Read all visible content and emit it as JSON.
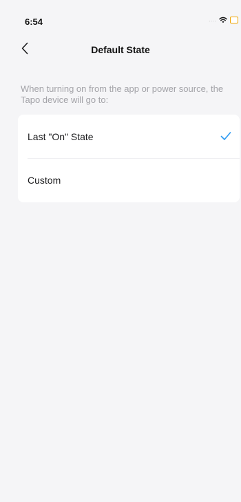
{
  "status_bar": {
    "time": "6:54",
    "signal": "....",
    "wifi_icon": "wifi-icon",
    "battery_icon": "battery-icon"
  },
  "nav": {
    "back_icon": "chevron-left-icon",
    "title": "Default State"
  },
  "description": "When turning on from the app or power source, the Tapo device will go to:",
  "options": [
    {
      "label": "Last \"On\" State",
      "selected": true
    },
    {
      "label": "Custom",
      "selected": false
    }
  ],
  "colors": {
    "accent": "#2f9bf2",
    "background": "#f5f5f7",
    "card": "#ffffff",
    "muted_text": "#a3a3a8",
    "battery": "#f0a400"
  }
}
